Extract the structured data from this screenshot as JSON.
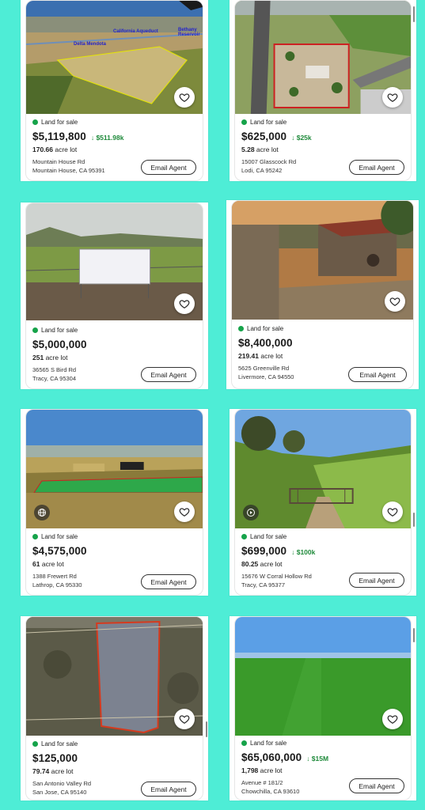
{
  "listings": [
    {
      "status": "Land for sale",
      "price": "$5,119,800",
      "drop": "↓ $511.98k",
      "size_num": "170.66",
      "size_unit": "acre lot",
      "addr1": "Mountain House Rd",
      "addr2": "Mountain House, CA 95391",
      "button": "Email Agent",
      "photo_labels": [
        "California Aqueduct",
        "Bethany Reservoir",
        "Delta Mendota"
      ]
    },
    {
      "status": "Land for sale",
      "price": "$625,000",
      "drop": "↓ $25k",
      "size_num": "5.28",
      "size_unit": "acre lot",
      "addr1": "15007 Glasscock Rd",
      "addr2": "Lodi, CA 95242",
      "button": "Email Agent"
    },
    {
      "status": "Land for sale",
      "price": "$5,000,000",
      "drop": "",
      "size_num": "251",
      "size_unit": "acre lot",
      "addr1": "36565 S Bird Rd",
      "addr2": "Tracy, CA 95304",
      "button": "Email Agent"
    },
    {
      "status": "Land for sale",
      "price": "$8,400,000",
      "drop": "",
      "size_num": "219.41",
      "size_unit": "acre lot",
      "addr1": "5625 Greenville Rd",
      "addr2": "Livermore, CA 94550",
      "button": "Email Agent"
    },
    {
      "status": "Land for sale",
      "price": "$4,575,000",
      "drop": "",
      "size_num": "61",
      "size_unit": "acre lot",
      "addr1": "1388 Frewert Rd",
      "addr2": "Lathrop, CA 95330",
      "button": "Email Agent"
    },
    {
      "status": "Land for sale",
      "price": "$699,000",
      "drop": "↓ $100k",
      "size_num": "80.25",
      "size_unit": "acre lot",
      "addr1": "15676 W Corral Hollow Rd",
      "addr2": "Tracy, CA 95377",
      "button": "Email Agent"
    },
    {
      "status": "Land for sale",
      "price": "$125,000",
      "drop": "",
      "size_num": "79.74",
      "size_unit": "acre lot",
      "addr1": "San Antonio Valley Rd",
      "addr2": "San Jose, CA 95140",
      "button": "Email Agent"
    },
    {
      "status": "Land for sale",
      "price": "$65,060,000",
      "drop": "↓ $15M",
      "size_num": "1,798",
      "size_unit": "acre lot",
      "addr1": "Avenue # 181/2",
      "addr2": "Chowchilla, CA 93610",
      "button": "Email Agent"
    }
  ],
  "icons": {
    "favorite": "heart-icon",
    "status": "green-dot",
    "globe": "globe-icon",
    "video": "play-icon"
  },
  "colors": {
    "background": "#4eedd6",
    "status_dot": "#16a34a",
    "price_drop": "#1e8a3a"
  }
}
